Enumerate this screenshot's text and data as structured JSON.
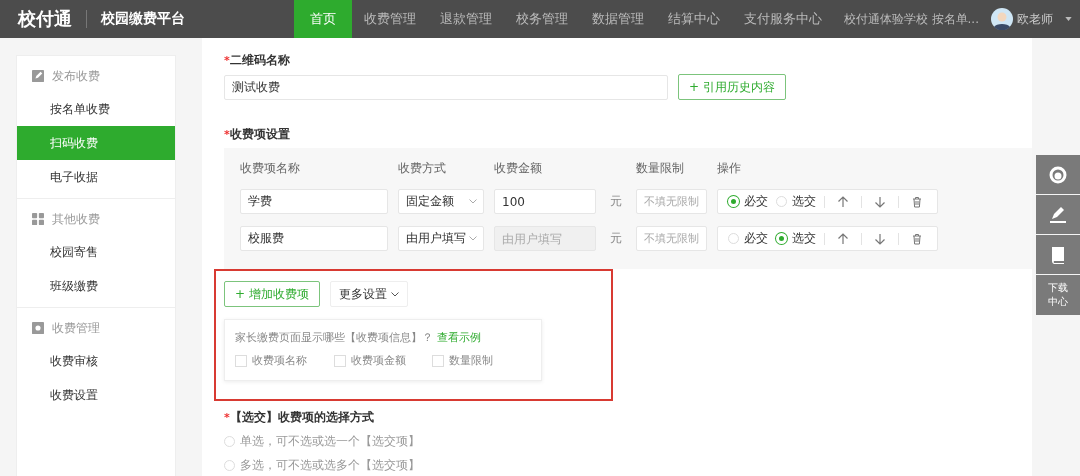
{
  "brand": {
    "logo": "校付通",
    "platform": "校园缴费平台"
  },
  "nav": [
    {
      "label": "首页",
      "selected": true
    },
    {
      "label": "收费管理",
      "selected": false
    },
    {
      "label": "退款管理",
      "selected": false
    },
    {
      "label": "校务管理",
      "selected": false
    },
    {
      "label": "数据管理",
      "selected": false
    },
    {
      "label": "结算中心",
      "selected": false
    },
    {
      "label": "支付服务中心",
      "selected": false
    }
  ],
  "user": {
    "school": "校付通体验学校 按名单...",
    "name": "欧老师"
  },
  "sidebar": [
    {
      "heading": "发布收费",
      "kind": "edit",
      "items": [
        {
          "label": "按名单收费",
          "selected": false
        },
        {
          "label": "扫码收费",
          "selected": true
        },
        {
          "label": "电子收据",
          "selected": false
        }
      ]
    },
    {
      "heading": "其他收费",
      "kind": "grid",
      "items": [
        {
          "label": "校园寄售",
          "selected": false
        },
        {
          "label": "班级缴费",
          "selected": false
        }
      ]
    },
    {
      "heading": "收费管理",
      "kind": "gear",
      "items": [
        {
          "label": "收费审核",
          "selected": false
        },
        {
          "label": "收费设置",
          "selected": false
        }
      ]
    }
  ],
  "form": {
    "qr_required": "*",
    "qr_label": "二维码名称",
    "qr_value": "测试收费",
    "history_button": "+ 引用历史内容",
    "items_required": "*",
    "items_label": "收费项设置",
    "columns": [
      "收费项名称",
      "收费方式",
      "收费金额",
      "数量限制",
      "操作"
    ],
    "rows": [
      {
        "name": "学费",
        "method": "固定金额",
        "amount": "100",
        "amount_disabled": false,
        "unit": "元",
        "limit_placeholder": "不填无限制",
        "options": [
          {
            "label": "必交",
            "selected": true
          },
          {
            "label": "选交",
            "selected": false
          }
        ]
      },
      {
        "name": "校服费",
        "method": "由用户填写",
        "amount_placeholder": "由用户填写",
        "amount_disabled": true,
        "unit": "元",
        "limit_placeholder": "不填无限制",
        "options": [
          {
            "label": "必交",
            "selected": false
          },
          {
            "label": "选交",
            "selected": true
          }
        ]
      }
    ],
    "add_button": "+ 增加收费项",
    "more_button": "更多设置",
    "popover": {
      "question": "家长缴费页面显示哪些【收费项信息】？",
      "link": "查看示例",
      "checks": [
        {
          "label": "收费项名称",
          "checked": false
        },
        {
          "label": "收费项金额",
          "checked": false
        },
        {
          "label": "数量限制",
          "checked": false
        }
      ]
    },
    "selection": {
      "required": "*",
      "label": "【选交】收费项的选择方式",
      "options": [
        {
          "label": "单选，可不选或选一个【选交项】",
          "selected": false
        },
        {
          "label": "多选，可不选或选多个【选交项】",
          "selected": false
        }
      ]
    }
  },
  "side_tools": [
    {
      "kind": "service"
    },
    {
      "kind": "edit"
    },
    {
      "kind": "book"
    },
    {
      "kind": "text",
      "label": "下载中心"
    }
  ]
}
